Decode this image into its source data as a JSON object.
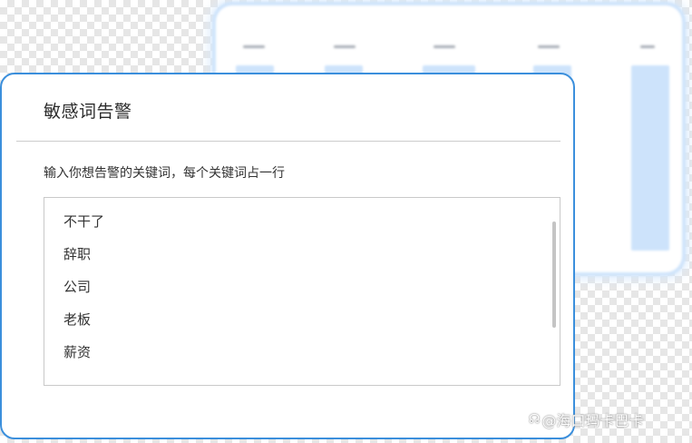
{
  "dialog": {
    "title": "敏感词告警",
    "instruction": "输入你想告警的关键词，每个关键词占一行",
    "keywords": [
      "不干了",
      "辞职",
      "公司",
      "老板",
      "薪资"
    ]
  },
  "watermark": {
    "icon": "headphone-icon",
    "text": "@海口玛卡巴卡"
  },
  "colors": {
    "dialog_border": "#3b8fdc",
    "background_bar": "#cde3fb"
  }
}
